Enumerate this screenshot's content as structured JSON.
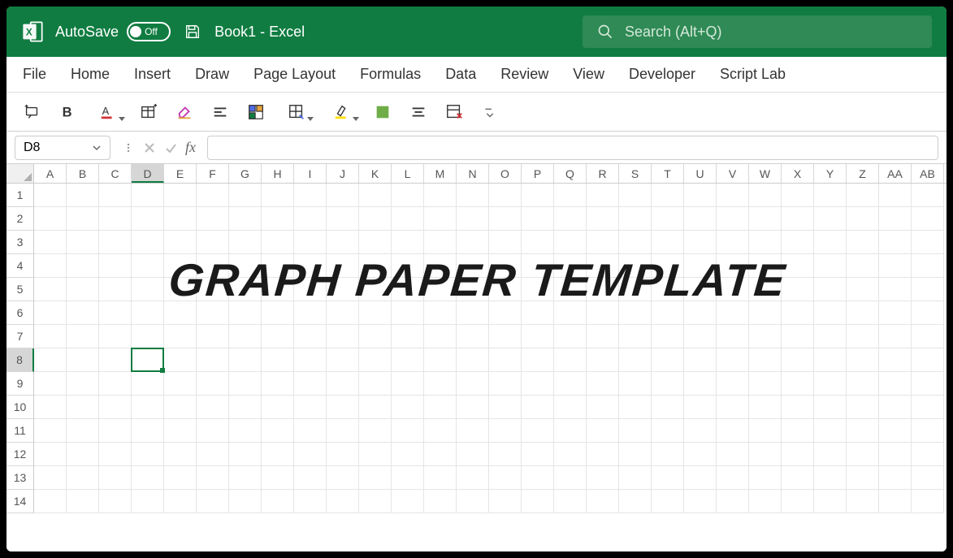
{
  "titlebar": {
    "autosave_label": "AutoSave",
    "autosave_state": "Off",
    "doc_name": "Book1",
    "app_suffix": " -  Excel",
    "search_placeholder": "Search (Alt+Q)"
  },
  "ribbon": {
    "tabs": [
      "File",
      "Home",
      "Insert",
      "Draw",
      "Page Layout",
      "Formulas",
      "Data",
      "Review",
      "View",
      "Developer",
      "Script Lab"
    ]
  },
  "toolbar_icons": [
    "add-comment",
    "bold",
    "font-color",
    "table",
    "clear-format",
    "align",
    "pivot",
    "borders",
    "highlight",
    "fill-color",
    "align-center",
    "conditional",
    "overflow"
  ],
  "formula_bar": {
    "name_box": "D8",
    "fx_label": "fx",
    "formula_value": ""
  },
  "grid": {
    "columns": [
      "A",
      "B",
      "C",
      "D",
      "E",
      "F",
      "G",
      "H",
      "I",
      "J",
      "K",
      "L",
      "M",
      "N",
      "O",
      "P",
      "Q",
      "R",
      "S",
      "T",
      "U",
      "V",
      "W",
      "X",
      "Y",
      "Z",
      "AA",
      "AB"
    ],
    "rows": [
      1,
      2,
      3,
      4,
      5,
      6,
      7,
      8,
      9,
      10,
      11,
      12,
      13,
      14
    ],
    "selected_col": "D",
    "selected_row": 8,
    "selected_col_index": 3,
    "selected_row_index": 7
  },
  "overlay": {
    "text": "GRAPH PAPER TEMPLATE"
  }
}
